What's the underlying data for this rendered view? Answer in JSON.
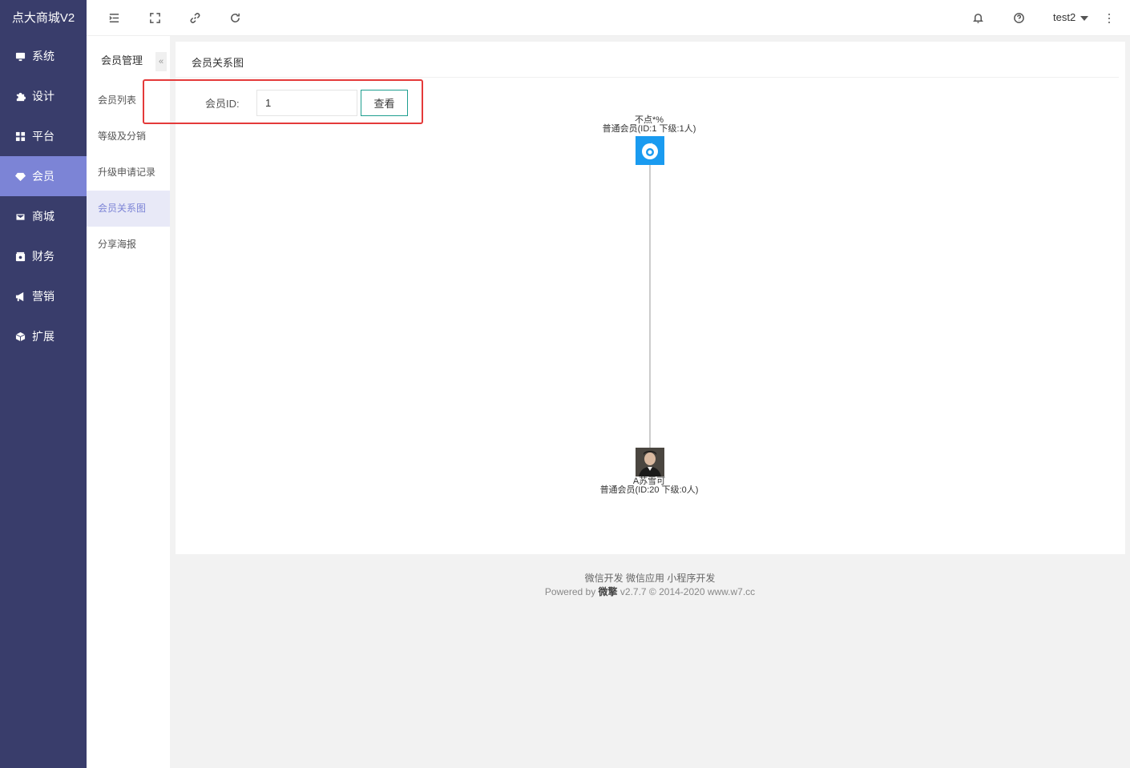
{
  "brand": "点大商城V2",
  "sidebar": {
    "items": [
      {
        "label": "系统",
        "icon": "monitor-icon"
      },
      {
        "label": "设计",
        "icon": "puzzle-icon"
      },
      {
        "label": "平台",
        "icon": "grid-icon"
      },
      {
        "label": "会员",
        "icon": "diamond-icon",
        "active": true
      },
      {
        "label": "商城",
        "icon": "shop-icon"
      },
      {
        "label": "财务",
        "icon": "wallet-icon"
      },
      {
        "label": "营销",
        "icon": "megaphone-icon"
      },
      {
        "label": "扩展",
        "icon": "cube-icon"
      }
    ]
  },
  "subnav": {
    "title": "会员管理",
    "collapse": "«",
    "items": [
      {
        "label": "会员列表"
      },
      {
        "label": "等级及分销"
      },
      {
        "label": "升级申请记录"
      },
      {
        "label": "会员关系图",
        "active": true
      },
      {
        "label": "分享海报"
      }
    ]
  },
  "header": {
    "icons": [
      "menu-fold-icon",
      "fullscreen-icon",
      "link-icon",
      "refresh-icon",
      "bell-icon",
      "help-icon"
    ],
    "user": "test2"
  },
  "page": {
    "title": "会员关系图",
    "search_label": "会员ID:",
    "member_id_value": "1",
    "view_button": "查看"
  },
  "tree": {
    "root": {
      "name": "不点*%",
      "info": "普通会员(ID:1 下级:1人)"
    },
    "child": {
      "name": "A苏雪可",
      "info": "普通会员(ID:20 下级:0人)"
    }
  },
  "footer": {
    "links": "微信开发 微信应用 小程序开发",
    "powered_prefix": "Powered by",
    "powered_brand": "微擎",
    "powered_suffix": "v2.7.7 © 2014-2020 www.w7.cc"
  },
  "colors": {
    "sidebar_bg": "#393d6b",
    "active_nav": "#7c84d6",
    "button_border": "#1e9e8f",
    "highlight": "#e43a3a"
  }
}
